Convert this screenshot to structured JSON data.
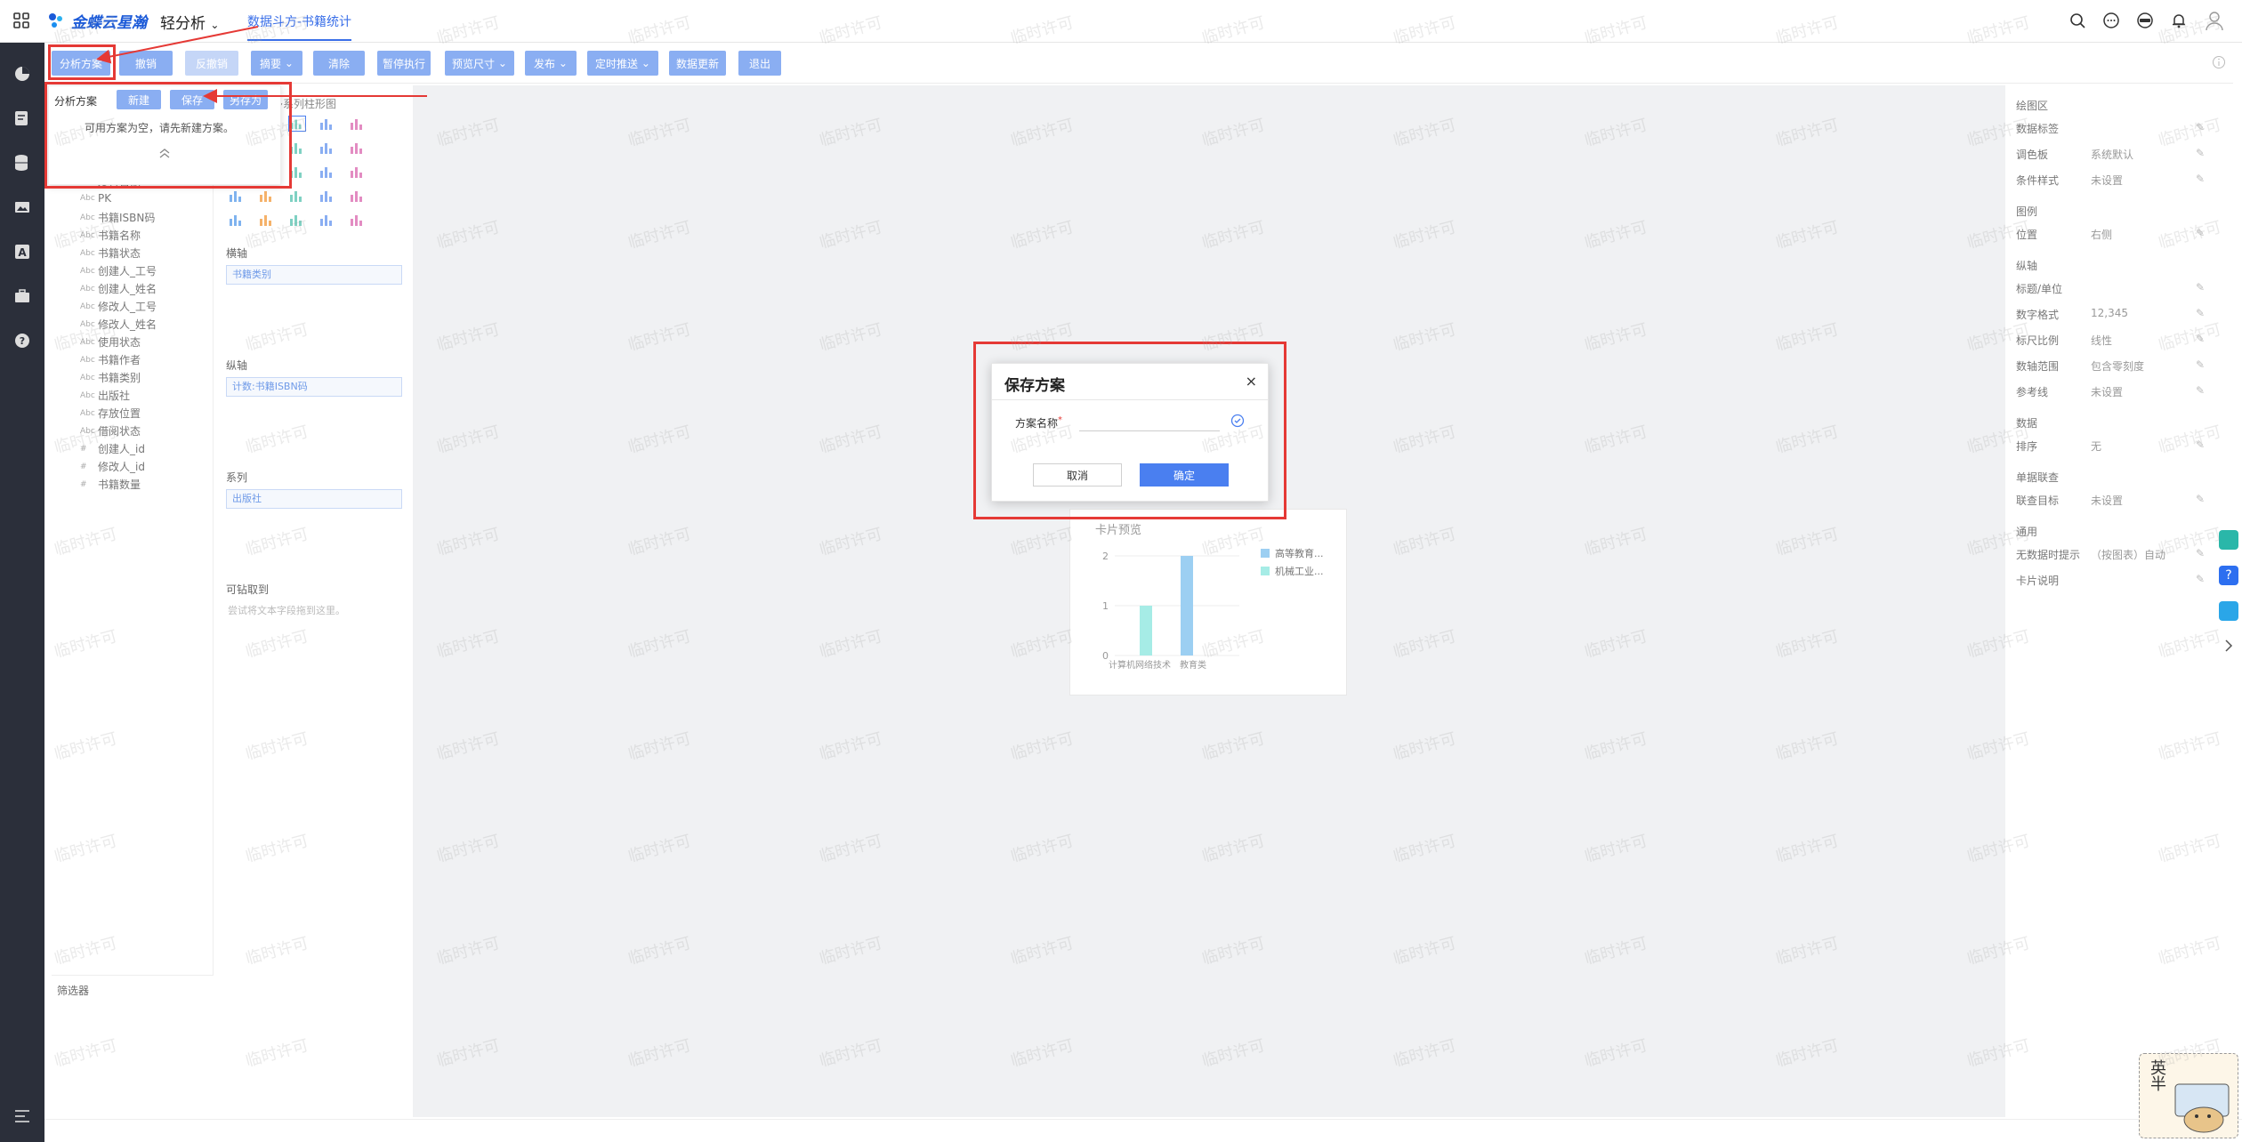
{
  "topbar": {
    "logo_text": "金蝶云星瀚",
    "app_switch": "轻分析",
    "active_tab": "数据斗方-书籍统计"
  },
  "toolbar": {
    "buttons": [
      "分析方案",
      "撤销",
      "反撤销",
      "摘要",
      "清除",
      "暂停执行",
      "预览尺寸",
      "发布",
      "定时推送",
      "数据更新",
      "退出"
    ]
  },
  "fields": {
    "items": [
      {
        "type": "date",
        "label": "发行日期"
      },
      {
        "type": "abc",
        "label": "PK"
      },
      {
        "type": "abc",
        "label": "书籍ISBN码"
      },
      {
        "type": "abc",
        "label": "书籍名称"
      },
      {
        "type": "abc",
        "label": "书籍状态"
      },
      {
        "type": "abc",
        "label": "创建人_工号"
      },
      {
        "type": "abc",
        "label": "创建人_姓名"
      },
      {
        "type": "abc",
        "label": "修改人_工号"
      },
      {
        "type": "abc",
        "label": "修改人_姓名"
      },
      {
        "type": "abc",
        "label": "使用状态"
      },
      {
        "type": "abc",
        "label": "书籍作者"
      },
      {
        "type": "abc",
        "label": "书籍类别"
      },
      {
        "type": "abc",
        "label": "出版社"
      },
      {
        "type": "abc",
        "label": "存放位置"
      },
      {
        "type": "abc",
        "label": "借阅状态"
      },
      {
        "type": "num",
        "label": "创建人_id"
      },
      {
        "type": "num",
        "label": "修改人_id"
      },
      {
        "type": "num",
        "label": "书籍数量"
      }
    ],
    "filter_title": "筛选器"
  },
  "chart_panel": {
    "chart_type_title": "多系列柱形图",
    "row_label": "横轴",
    "row_value": "书籍类别",
    "col_label": "纵轴",
    "col_value": "计数:书籍ISBN码",
    "series_label": "系列",
    "series_value": "出版社",
    "tooltip_label": "可钻取到",
    "tooltip_hint": "尝试将文本字段拖到这里。"
  },
  "popover": {
    "title": "分析方案",
    "new_btn": "新建",
    "save_btn": "保存",
    "saveas_btn": "另存为",
    "message": "可用方案为空，请先新建方案。",
    "collapse_icon": "chevron-up-double-icon"
  },
  "dialog": {
    "title": "保存方案",
    "close": "×",
    "label": "方案名称",
    "required": "*",
    "input_value": "",
    "cancel": "取消",
    "confirm": "确定"
  },
  "card": {
    "title": "卡片预览"
  },
  "chart_data": {
    "type": "bar",
    "categories": [
      "计算机网络技术",
      "教育类"
    ],
    "series": [
      {
        "name": "高等教育...",
        "values": [
          0,
          2
        ],
        "color": "#9ccff2"
      },
      {
        "name": "机械工业...",
        "values": [
          1,
          0
        ],
        "color": "#a6ece6"
      }
    ],
    "yticks": [
      "0",
      "1",
      "2"
    ],
    "ylim": [
      0,
      2
    ],
    "legend": "right"
  },
  "right_panel": {
    "sections": [
      {
        "title": "绘图区",
        "rows": [
          {
            "k": "数据标签",
            "v": ""
          },
          {
            "k": "调色板",
            "v": "系统默认"
          },
          {
            "k": "条件样式",
            "v": "未设置"
          }
        ]
      },
      {
        "title": "图例",
        "rows": [
          {
            "k": "位置",
            "v": "右侧"
          }
        ]
      },
      {
        "title": "纵轴",
        "rows": [
          {
            "k": "标题/单位",
            "v": ""
          },
          {
            "k": "数字格式",
            "v": "12,345"
          },
          {
            "k": "标尺比例",
            "v": "线性"
          },
          {
            "k": "数轴范围",
            "v": "包含零刻度"
          },
          {
            "k": "参考线",
            "v": "未设置"
          }
        ]
      },
      {
        "title": "数据",
        "rows": [
          {
            "k": "排序",
            "v": "无"
          }
        ]
      },
      {
        "title": "单据联查",
        "rows": [
          {
            "k": "联查目标",
            "v": "未设置"
          }
        ]
      },
      {
        "title": "通用",
        "rows": [
          {
            "k": "无数据时提示",
            "v": "（按图表）自动"
          },
          {
            "k": "卡片说明",
            "v": ""
          }
        ]
      }
    ]
  },
  "sticker": {
    "chars": "英半"
  },
  "watermark": "临时许可",
  "colors": {
    "accent": "#4a7ff0",
    "toolbar_btn": "#8aaef2",
    "highlight": "#e53935",
    "nav": "#2b2f3a"
  }
}
